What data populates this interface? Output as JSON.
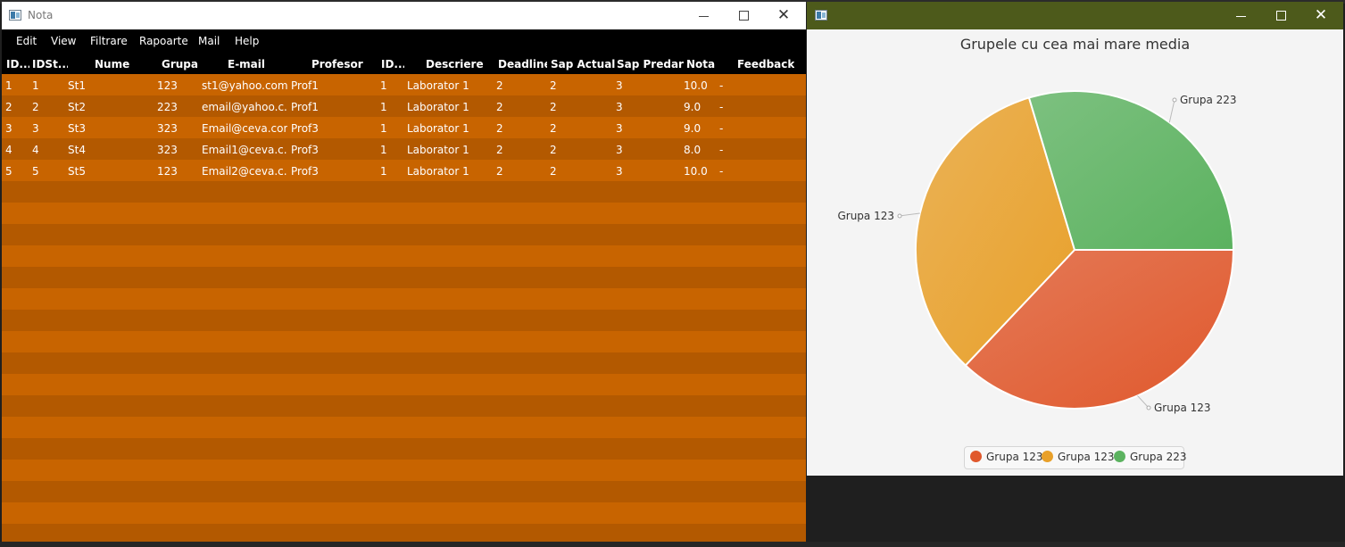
{
  "nota_window": {
    "title": "Nota",
    "controls": {
      "minimize": "minimize",
      "maximize": "maximize",
      "close": "✕"
    },
    "menu": [
      "Edit",
      "View",
      "Filtrare",
      "Rapoarte",
      "Mail",
      "Help"
    ],
    "columns": [
      "ID...",
      "IDSt...",
      "Nume",
      "Grupa",
      "E-mail",
      "Profesor",
      "ID...",
      "Descriere",
      "Deadline",
      "Sap Actuala",
      "Sap Predare",
      "Nota",
      "Feedback"
    ],
    "rows": [
      [
        "1",
        "1",
        "St1",
        "123",
        "st1@yahoo.com",
        "Prof1",
        "1",
        "Laborator 1",
        "2",
        "2",
        "3",
        "10.0",
        "-"
      ],
      [
        "2",
        "2",
        "St2",
        "223",
        "email@yahoo.c...",
        "Prof1",
        "1",
        "Laborator 1",
        "2",
        "2",
        "3",
        "9.0",
        "-"
      ],
      [
        "3",
        "3",
        "St3",
        "323",
        "Email@ceva.com",
        "Prof3",
        "1",
        "Laborator 1",
        "2",
        "2",
        "3",
        "9.0",
        "-"
      ],
      [
        "4",
        "4",
        "St4",
        "323",
        "Email1@ceva.c...",
        "Prof3",
        "1",
        "Laborator 1",
        "2",
        "2",
        "3",
        "8.0",
        "-"
      ],
      [
        "5",
        "5",
        "St5",
        "123",
        "Email2@ceva.c...",
        "Prof3",
        "1",
        "Laborator 1",
        "2",
        "2",
        "3",
        "10.0",
        "-"
      ]
    ],
    "colors": {
      "row_even": "#b35900",
      "row_odd": "#c86400",
      "header_bg": "#000000",
      "text": "#ffffff"
    }
  },
  "chart_window": {
    "controls": {
      "minimize": "minimize",
      "maximize": "maximize",
      "close": "✕"
    },
    "titlebar_color": "#4d5a1b"
  },
  "chart_data": {
    "type": "pie",
    "title": "Grupele cu cea mai mare media",
    "slices": [
      {
        "label": "Grupa 123",
        "value": 10.0,
        "color": "#e0582c"
      },
      {
        "label": "Grupa 123",
        "value": 9.0,
        "color": "#e8a02a"
      },
      {
        "label": "Grupa 223",
        "value": 8.0,
        "color": "#5bb25f"
      }
    ],
    "legend_position": "bottom",
    "legend": [
      "Grupa 123",
      "Grupa 123",
      "Grupa 223"
    ]
  }
}
